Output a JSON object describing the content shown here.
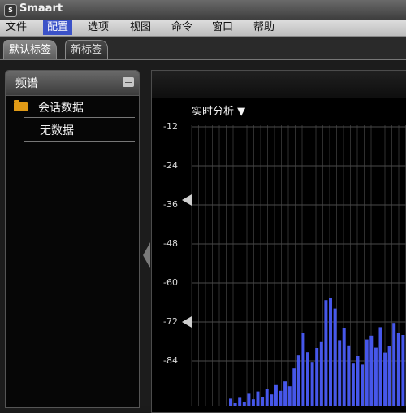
{
  "app": {
    "title": "Smaart",
    "icon": "app-logo-icon",
    "icon_text": "S"
  },
  "menu": {
    "items": [
      "文件",
      "配置",
      "选项",
      "视图",
      "命令",
      "窗口",
      "帮助"
    ],
    "active_index": 1,
    "active_color": "#3b52c8"
  },
  "tabs": [
    {
      "label": "默认标签",
      "selected": true
    },
    {
      "label": "新标签",
      "selected": false
    }
  ],
  "left_panel": {
    "title": "频谱",
    "menu_icon": "list-menu-icon",
    "items": [
      {
        "label": "会话数据",
        "icon": "folder-icon"
      },
      {
        "label": "无数据"
      }
    ]
  },
  "chart_title": "实时分析 ▼",
  "chart_data": {
    "type": "bar",
    "title": "实时分析",
    "y_ticks": [
      "-12",
      "-24",
      "-36",
      "-48",
      "-60",
      "-72",
      "-84"
    ],
    "ylim": [
      -98,
      -3
    ],
    "grid": true,
    "bar_color": "#4657ea",
    "values": [
      -95.6,
      -97.0,
      -95.1,
      -96.5,
      -94.1,
      -95.8,
      -93.4,
      -95.0,
      -92.7,
      -94.3,
      -91.2,
      -93.2,
      -90.3,
      -91.8,
      -86.3,
      -82.3,
      -75.4,
      -81.3,
      -84.3,
      -80.0,
      -78.2,
      -65.3,
      -64.5,
      -67.9,
      -77.6,
      -74.0,
      -79.2,
      -84.8,
      -82.5,
      -85.1,
      -77.4,
      -76.2,
      -79.9,
      -73.6,
      -81.4,
      -79.5,
      -72.3,
      -75.5,
      -76.0
    ]
  }
}
